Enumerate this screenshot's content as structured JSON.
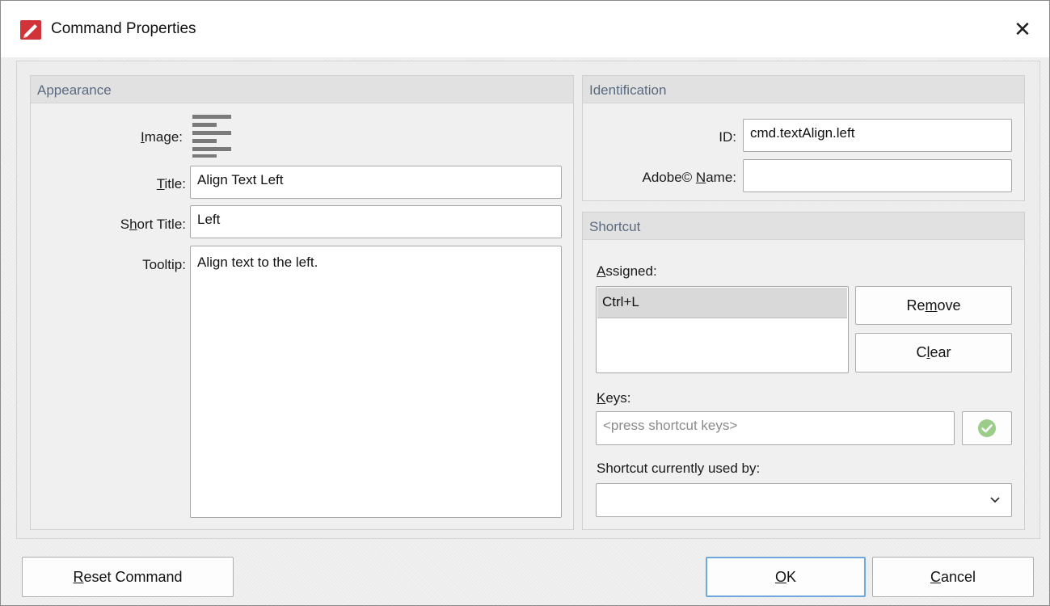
{
  "window": {
    "title": "Command Properties",
    "close_glyph": "✕",
    "accent_color": "#d13438"
  },
  "appearance": {
    "header": "Appearance",
    "image_label": "Image:",
    "image_icon": "align-left-icon",
    "title_label": "Title:",
    "title_value": "Align Text Left",
    "short_title_label": "Short Title:",
    "short_title_value": "Left",
    "tooltip_label": "Tooltip:",
    "tooltip_value": "Align text to the left."
  },
  "identification": {
    "header": "Identification",
    "id_label": "ID:",
    "id_value": "cmd.textAlign.left",
    "adobe_name_label": "Adobe© Name:",
    "adobe_name_value": ""
  },
  "shortcut": {
    "header": "Shortcut",
    "assigned_label": "Assigned:",
    "assigned_items": [
      "Ctrl+L"
    ],
    "remove_label": "Remove",
    "clear_label": "Clear",
    "keys_label": "Keys:",
    "keys_placeholder": "<press shortcut keys>",
    "confirm_icon": "check-circle-icon",
    "used_by_label": "Shortcut currently used by:",
    "used_by_value": ""
  },
  "footer": {
    "reset_label": "Reset Command",
    "ok_label": "OK",
    "cancel_label": "Cancel"
  }
}
